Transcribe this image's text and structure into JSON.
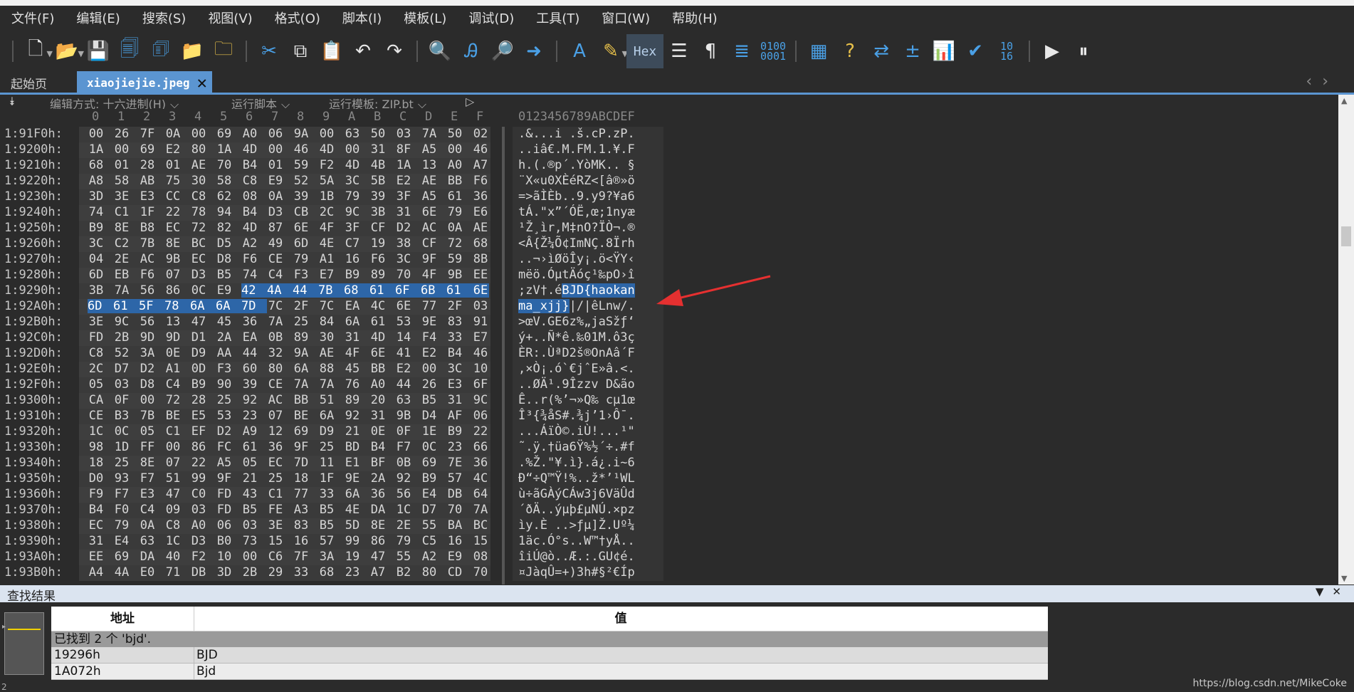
{
  "menu": [
    "文件(F)",
    "编辑(E)",
    "搜索(S)",
    "视图(V)",
    "格式(O)",
    "脚本(I)",
    "模板(L)",
    "调试(D)",
    "工具(T)",
    "窗口(W)",
    "帮助(H)"
  ],
  "toolbar": {
    "hex_label": "Hex",
    "pilcrow": "¶",
    "binary_label": "0100 0001",
    "base_label": "10 16",
    "format_label": "A"
  },
  "tabs": {
    "home": "起始页",
    "active": "xiaojiejie.jpeg"
  },
  "options": {
    "edit_mode": "编辑方式: 十六进制(H)",
    "run_script": "运行脚本",
    "run_template": "运行模板: ZIP.bt"
  },
  "column_header": {
    "hex_cols": [
      "0",
      "1",
      "2",
      "3",
      "4",
      "5",
      "6",
      "7",
      "8",
      "9",
      "A",
      "B",
      "C",
      "D",
      "E",
      "F"
    ],
    "ascii_header": "0123456789ABCDEF"
  },
  "hex_rows": [
    {
      "addr": "1:91F0h:",
      "bytes": [
        "00",
        "26",
        "7F",
        "0A",
        "00",
        "69",
        "A0",
        "06",
        "9A",
        "00",
        "63",
        "50",
        "03",
        "7A",
        "50",
        "02"
      ],
      "ascii": ".&...i .š.cP.zP."
    },
    {
      "addr": "1:9200h:",
      "bytes": [
        "1A",
        "00",
        "69",
        "E2",
        "80",
        "1A",
        "4D",
        "00",
        "46",
        "4D",
        "00",
        "31",
        "8F",
        "A5",
        "00",
        "46"
      ],
      "ascii": "..iâ€.M.FM.1.¥.F"
    },
    {
      "addr": "1:9210h:",
      "bytes": [
        "68",
        "01",
        "28",
        "01",
        "AE",
        "70",
        "B4",
        "01",
        "59",
        "F2",
        "4D",
        "4B",
        "1A",
        "13",
        "A0",
        "A7"
      ],
      "ascii": "h.(.®p´.YòMK.. §"
    },
    {
      "addr": "1:9220h:",
      "bytes": [
        "A8",
        "58",
        "AB",
        "75",
        "30",
        "58",
        "C8",
        "E9",
        "52",
        "5A",
        "3C",
        "5B",
        "E2",
        "AE",
        "BB",
        "F6"
      ],
      "ascii": "¨X«u0XÈéRZ<[â®»ö"
    },
    {
      "addr": "1:9230h:",
      "bytes": [
        "3D",
        "3E",
        "E3",
        "CC",
        "C8",
        "62",
        "08",
        "0A",
        "39",
        "1B",
        "79",
        "39",
        "3F",
        "A5",
        "61",
        "36"
      ],
      "ascii": "=>ãÌÈb..9.y9?¥a6"
    },
    {
      "addr": "1:9240h:",
      "bytes": [
        "74",
        "C1",
        "1F",
        "22",
        "78",
        "94",
        "B4",
        "D3",
        "CB",
        "2C",
        "9C",
        "3B",
        "31",
        "6E",
        "79",
        "E6"
      ],
      "ascii": "tÁ.\"x”´ÓË,œ;1nyæ"
    },
    {
      "addr": "1:9250h:",
      "bytes": [
        "B9",
        "8E",
        "B8",
        "EC",
        "72",
        "82",
        "4D",
        "87",
        "6E",
        "4F",
        "3F",
        "CF",
        "D2",
        "AC",
        "0A",
        "AE"
      ],
      "ascii": "¹Ž¸ìr‚M‡nO?ÏÒ¬.®"
    },
    {
      "addr": "1:9260h:",
      "bytes": [
        "3C",
        "C2",
        "7B",
        "8E",
        "BC",
        "D5",
        "A2",
        "49",
        "6D",
        "4E",
        "C7",
        "19",
        "38",
        "CF",
        "72",
        "68"
      ],
      "ascii": "<Â{Ž¼Õ¢ImNÇ.8Ïrh"
    },
    {
      "addr": "1:9270h:",
      "bytes": [
        "04",
        "2E",
        "AC",
        "9B",
        "EC",
        "D8",
        "F6",
        "CE",
        "79",
        "A1",
        "16",
        "F6",
        "3C",
        "9F",
        "59",
        "8B"
      ],
      "ascii": "..¬›ìØöÎy¡.ö<ŸY‹"
    },
    {
      "addr": "1:9280h:",
      "bytes": [
        "6D",
        "EB",
        "F6",
        "07",
        "D3",
        "B5",
        "74",
        "C4",
        "F3",
        "E7",
        "B9",
        "89",
        "70",
        "4F",
        "9B",
        "EE"
      ],
      "ascii": "mëö.ÓµtÄóç¹‰pO›î"
    },
    {
      "addr": "1:9290h:",
      "bytes": [
        "3B",
        "7A",
        "56",
        "86",
        "0C",
        "E9",
        "42",
        "4A",
        "44",
        "7B",
        "68",
        "61",
        "6F",
        "6B",
        "61",
        "6E"
      ],
      "ascii": ";zV†.éBJD{haokan",
      "sel_from": 6
    },
    {
      "addr": "1:92A0h:",
      "bytes": [
        "6D",
        "61",
        "5F",
        "78",
        "6A",
        "6A",
        "7D",
        "7C",
        "2F",
        "7C",
        "EA",
        "4C",
        "6E",
        "77",
        "2F",
        "03"
      ],
      "ascii": "ma_xjj}|/|êLnw/.",
      "sel_to": 6
    },
    {
      "addr": "1:92B0h:",
      "bytes": [
        "3E",
        "9C",
        "56",
        "13",
        "47",
        "45",
        "36",
        "7A",
        "25",
        "84",
        "6A",
        "61",
        "53",
        "9E",
        "83",
        "91"
      ],
      "ascii": ">œV.GE6z%„jaSžƒ‘"
    },
    {
      "addr": "1:92C0h:",
      "bytes": [
        "FD",
        "2B",
        "9D",
        "9D",
        "D1",
        "2A",
        "EA",
        "0B",
        "89",
        "30",
        "31",
        "4D",
        "14",
        "F4",
        "33",
        "E7"
      ],
      "ascii": "ý+..Ñ*ê.‰01M.ô3ç"
    },
    {
      "addr": "1:92D0h:",
      "bytes": [
        "C8",
        "52",
        "3A",
        "0E",
        "D9",
        "AA",
        "44",
        "32",
        "9A",
        "AE",
        "4F",
        "6E",
        "41",
        "E2",
        "B4",
        "46"
      ],
      "ascii": "ÈR:.ÙªD2š®OnAâ´F"
    },
    {
      "addr": "1:92E0h:",
      "bytes": [
        "2C",
        "D7",
        "D2",
        "A1",
        "0D",
        "F3",
        "60",
        "80",
        "6A",
        "88",
        "45",
        "BB",
        "E2",
        "00",
        "3C",
        "10"
      ],
      "ascii": ",×Ò¡.ó`€jˆE»â.<."
    },
    {
      "addr": "1:92F0h:",
      "bytes": [
        "05",
        "03",
        "D8",
        "C4",
        "B9",
        "90",
        "39",
        "CE",
        "7A",
        "7A",
        "76",
        "A0",
        "44",
        "26",
        "E3",
        "6F"
      ],
      "ascii": "..ØÄ¹.9Îzzv D&ão"
    },
    {
      "addr": "1:9300h:",
      "bytes": [
        "CA",
        "0F",
        "00",
        "72",
        "28",
        "25",
        "92",
        "AC",
        "BB",
        "51",
        "89",
        "20",
        "63",
        "B5",
        "31",
        "9C"
      ],
      "ascii": "Ê..r(%’¬»Q‰ cµ1œ"
    },
    {
      "addr": "1:9310h:",
      "bytes": [
        "CE",
        "B3",
        "7B",
        "BE",
        "E5",
        "53",
        "23",
        "07",
        "BE",
        "6A",
        "92",
        "31",
        "9B",
        "D4",
        "AF",
        "06"
      ],
      "ascii": "Î³{¾åS#.¾j’1›Ô¯."
    },
    {
      "addr": "1:9320h:",
      "bytes": [
        "1C",
        "0C",
        "05",
        "C1",
        "EF",
        "D2",
        "A9",
        "12",
        "69",
        "D9",
        "21",
        "0E",
        "0F",
        "1E",
        "B9",
        "22"
      ],
      "ascii": "...ÁïÒ©.iÙ!...¹\""
    },
    {
      "addr": "1:9330h:",
      "bytes": [
        "98",
        "1D",
        "FF",
        "00",
        "86",
        "FC",
        "61",
        "36",
        "9F",
        "25",
        "BD",
        "B4",
        "F7",
        "0C",
        "23",
        "66"
      ],
      "ascii": "˜.ÿ.†üa6Ÿ%½´÷.#f"
    },
    {
      "addr": "1:9340h:",
      "bytes": [
        "18",
        "25",
        "8E",
        "07",
        "22",
        "A5",
        "05",
        "EC",
        "7D",
        "11",
        "E1",
        "BF",
        "0B",
        "69",
        "7E",
        "36"
      ],
      "ascii": ".%Ž.\"¥.ì}.á¿.i~6"
    },
    {
      "addr": "1:9350h:",
      "bytes": [
        "D0",
        "93",
        "F7",
        "51",
        "99",
        "9F",
        "21",
        "25",
        "18",
        "1F",
        "9E",
        "2A",
        "92",
        "B9",
        "57",
        "4C"
      ],
      "ascii": "Ð“÷Q™Ÿ!%..ž*’¹WL"
    },
    {
      "addr": "1:9360h:",
      "bytes": [
        "F9",
        "F7",
        "E3",
        "47",
        "C0",
        "FD",
        "43",
        "C1",
        "77",
        "33",
        "6A",
        "36",
        "56",
        "E4",
        "DB",
        "64"
      ],
      "ascii": "ù÷ãGÀýCÁw3j6VäÛd"
    },
    {
      "addr": "1:9370h:",
      "bytes": [
        "B4",
        "F0",
        "C4",
        "09",
        "03",
        "FD",
        "B5",
        "FE",
        "A3",
        "B5",
        "4E",
        "DA",
        "1C",
        "D7",
        "70",
        "7A"
      ],
      "ascii": "´ðÄ..ýµþ£µNÚ.×pz"
    },
    {
      "addr": "1:9380h:",
      "bytes": [
        "EC",
        "79",
        "0A",
        "C8",
        "A0",
        "06",
        "03",
        "3E",
        "83",
        "B5",
        "5D",
        "8E",
        "2E",
        "55",
        "BA",
        "BC"
      ],
      "ascii": "ìy.È ..>ƒµ]Ž.Uº¼"
    },
    {
      "addr": "1:9390h:",
      "bytes": [
        "31",
        "E4",
        "63",
        "1C",
        "D3",
        "B0",
        "73",
        "15",
        "16",
        "57",
        "99",
        "86",
        "79",
        "C5",
        "16",
        "15"
      ],
      "ascii": "1äc.Ó°s..W™†yÅ.."
    },
    {
      "addr": "1:93A0h:",
      "bytes": [
        "EE",
        "69",
        "DA",
        "40",
        "F2",
        "10",
        "00",
        "C6",
        "7F",
        "3A",
        "19",
        "47",
        "55",
        "A2",
        "E9",
        "08"
      ],
      "ascii": "îiÚ@ò..Æ.:.GU¢é."
    },
    {
      "addr": "1:93B0h:",
      "bytes": [
        "A4",
        "4A",
        "E0",
        "71",
        "DB",
        "3D",
        "2B",
        "29",
        "33",
        "68",
        "23",
        "A7",
        "B2",
        "80",
        "CD",
        "70"
      ],
      "ascii": "¤JàqÛ=+)3h#§²€Íp"
    }
  ],
  "find_results": {
    "title": "查找结果",
    "col_address": "地址",
    "col_value": "值",
    "summary": "已找到 2 个 'bjd'.",
    "rows": [
      {
        "address": "19296h",
        "value": "BJD"
      },
      {
        "address": "1A072h",
        "value": "Bjd"
      }
    ]
  },
  "watermark": "https://blog.csdn.net/MikeCoke",
  "status_number": "2"
}
